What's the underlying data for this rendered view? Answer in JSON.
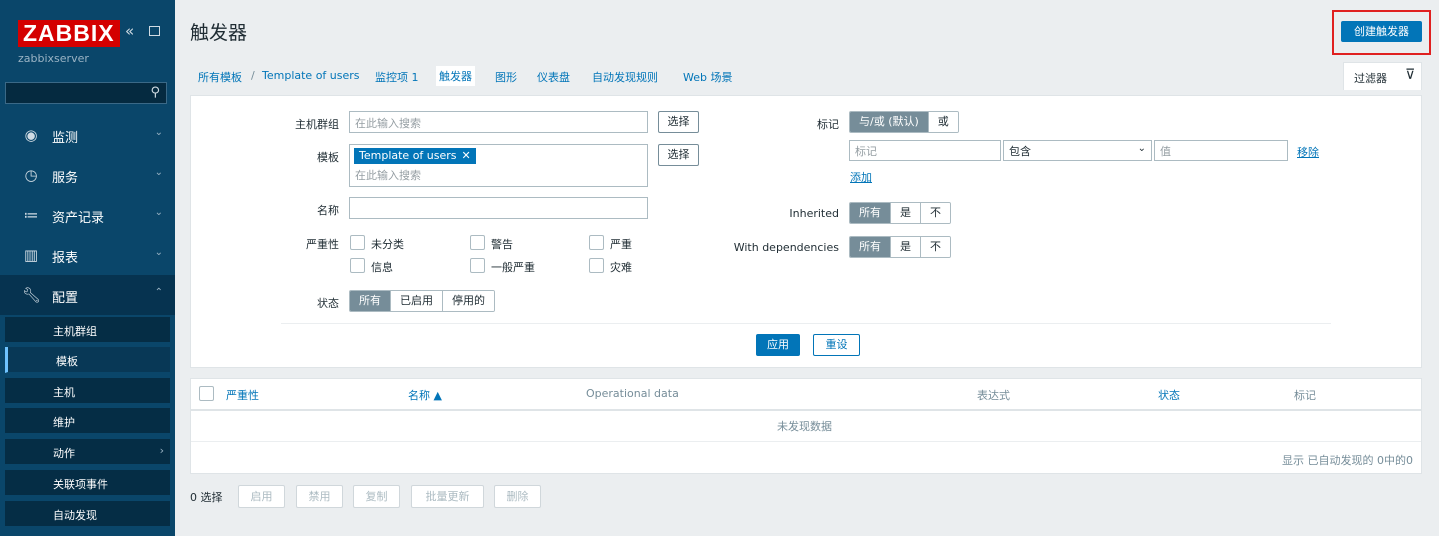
{
  "sidebar": {
    "logo": "ZABBIX",
    "server": "zabbixserver",
    "menu": [
      {
        "label": "监测",
        "icon": "eye-icon"
      },
      {
        "label": "服务",
        "icon": "clock-icon"
      },
      {
        "label": "资产记录",
        "icon": "list-icon"
      },
      {
        "label": "报表",
        "icon": "bar-chart-icon"
      },
      {
        "label": "配置",
        "icon": "wrench-icon"
      }
    ],
    "submenu": [
      "主机群组",
      "模板",
      "主机",
      "维护",
      "动作",
      "关联项事件",
      "自动发现"
    ]
  },
  "header": {
    "title": "触发器",
    "create_button": "创建触发器"
  },
  "breadcrumb": {
    "all_templates": "所有模板",
    "sep": "/",
    "template": "Template of users",
    "items": "监控项 1",
    "triggers": "触发器",
    "graphs": "图形",
    "dashboards": "仪表盘",
    "discovery": "自动发现规则",
    "web": "Web 场景"
  },
  "filter_tab": {
    "label": "过滤器"
  },
  "filter": {
    "host_group_label": "主机群组",
    "host_group_placeholder": "在此输入搜索",
    "select_label": "选择",
    "template_label": "模板",
    "template_chip": "Template of users",
    "template_placeholder": "在此输入搜索",
    "name_label": "名称",
    "severity_label": "严重性",
    "severities": [
      "未分类",
      "警告",
      "严重",
      "信息",
      "一般严重",
      "灾难"
    ],
    "state_label": "状态",
    "state_options": [
      "所有",
      "已启用",
      "停用的"
    ],
    "tags_label": "标记",
    "tags_mode": [
      "与/或 (默认)",
      "或"
    ],
    "tag_placeholder": "标记",
    "tag_operator": "包含",
    "value_placeholder": "值",
    "remove_link": "移除",
    "add_link": "添加",
    "inherited_label": "Inherited",
    "dependencies_label": "With dependencies",
    "tri_options": [
      "所有",
      "是",
      "不"
    ],
    "apply": "应用",
    "reset": "重设"
  },
  "table": {
    "columns": [
      "严重性",
      "名称 ▲",
      "Operational data",
      "表达式",
      "状态",
      "标记"
    ],
    "empty_text": "未发现数据",
    "footer": "显示 已自动发现的 0中的0"
  },
  "mass_actions": {
    "selected": "0 选择",
    "buttons": [
      "启用",
      "禁用",
      "复制",
      "批量更新",
      "删除"
    ]
  },
  "colors": {
    "sidebar": "#0a466a",
    "accent": "#0275b8",
    "brand": "#d40000",
    "highlight": "#e02020"
  }
}
